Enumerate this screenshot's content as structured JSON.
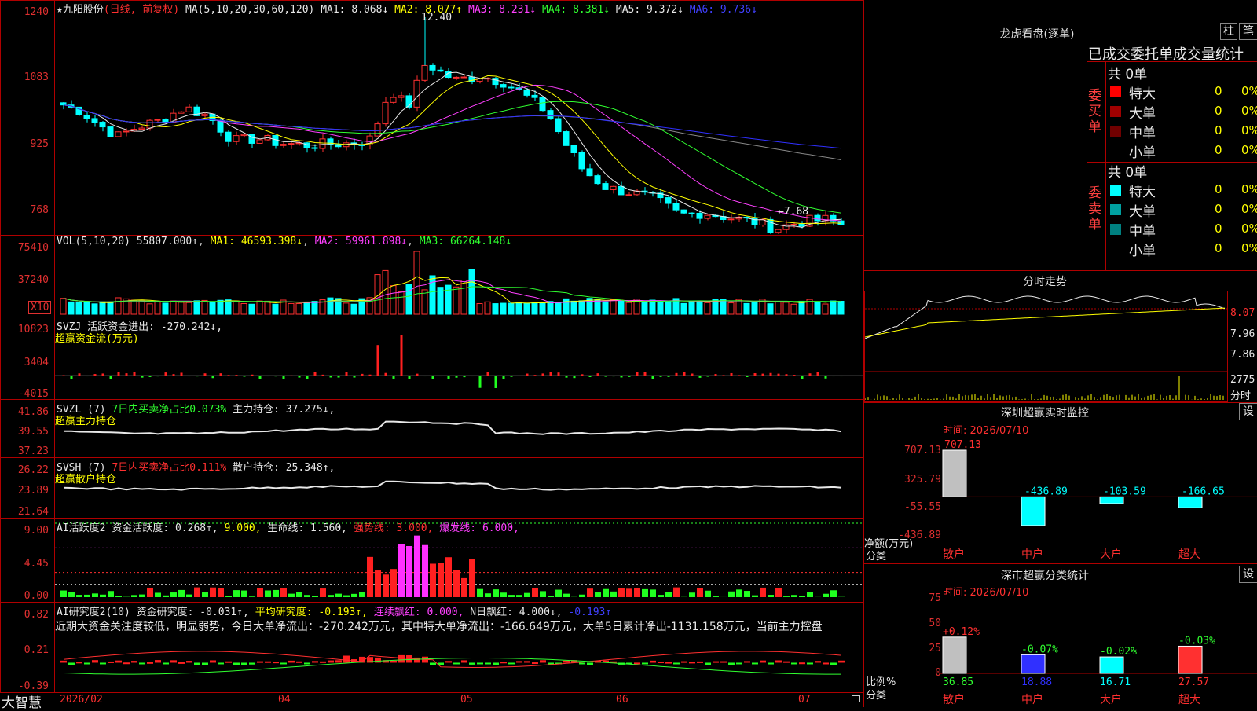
{
  "stock": {
    "star": "★",
    "name": "九阳股份",
    "mode": "(日线, 前复权)"
  },
  "ma_header": {
    "label": "MA(5,10,20,30,60,120)",
    "ma1": "MA1: 8.068↓",
    "ma2": "MA2: 8.077↑",
    "ma3": "MA3: 8.231↓",
    "ma4": "MA4: 8.381↓",
    "ma5": "MA5: 9.372↓",
    "ma6": "MA6: 9.736↓"
  },
  "price_axis": [
    "1240",
    "1083",
    "925",
    "768"
  ],
  "price_annotations": {
    "high": "12.40",
    "low": "←7.68"
  },
  "vol_header": {
    "label": "VOL(5,10,20)",
    "value": "55807.000↑",
    "ma1": "MA1: 46593.398↓",
    "ma2": "MA2: 59961.898↓",
    "ma3": "MA3: 66264.148↓"
  },
  "vol_axis": [
    "75410",
    "37240"
  ],
  "vol_unit": "X10",
  "svzj": {
    "label": "SVZJ  活跃资金进出: -270.242↓,",
    "sub": "超赢资金流(万元)",
    "axis": [
      "10823",
      "3404",
      "-4015"
    ]
  },
  "svzl": {
    "label": "SVZL (7)",
    "net": "7日内买卖净占比0.073%",
    "hold": "主力持仓: 37.275↓,",
    "sub": "超赢主力持仓",
    "axis": [
      "41.86",
      "39.55",
      "37.23"
    ]
  },
  "svsh": {
    "label": "SVSH (7)",
    "net": "7日内买卖净占比0.111%",
    "hold": "散户持仓: 25.348↑,",
    "sub": "超赢散户持仓",
    "axis": [
      "26.22",
      "23.89",
      "21.64"
    ]
  },
  "ai_active": {
    "label": "AI活跃度2",
    "a": "资金活跃度: 0.268↑,",
    "b": "9.000,",
    "c": "生命线: 1.560,",
    "d": "强势线: 3.000,",
    "e": "爆发线: 6.000,",
    "axis": [
      "9.00",
      "4.45",
      "0.00"
    ]
  },
  "ai_research": {
    "label": "AI研究度2(10)",
    "a": "资金研究度: -0.031↑,",
    "b": "平均研究度: -0.193↑,",
    "c": "连续飘红: 0.000,",
    "d": "N日飘红: 4.000↓,",
    "e": "-0.193↑",
    "axis": [
      "0.82",
      "0.21",
      "-0.39"
    ]
  },
  "ai_comment": "近期大资金关注度较低，明显弱势，今日大单净流出：-270.242万元，其中特大单净流出：-166.649万元，大单5日累计净出-1131.158万元，当前主力控盘",
  "date_axis": [
    "2026/02",
    "04",
    "05",
    "06",
    "07"
  ],
  "brand": "大智慧",
  "right_top": {
    "title": "龙虎看盘(逐单)",
    "btn1": "柱",
    "btn2": "笔",
    "header": "已成交委托单成交量统计",
    "buy_label": "委买单",
    "sell_label": "委卖单",
    "buy_total": "共 0单",
    "sell_total": "共 0单",
    "buy_rows": [
      {
        "name": "特大",
        "n": "0",
        "p": "0%",
        "color": "#ff0000"
      },
      {
        "name": "大单",
        "n": "0",
        "p": "0%",
        "color": "#a00000"
      },
      {
        "name": "中单",
        "n": "0",
        "p": "0%",
        "color": "#700000"
      },
      {
        "name": "小单",
        "n": "0",
        "p": "0%",
        "color": "#000000"
      }
    ],
    "sell_rows": [
      {
        "name": "特大",
        "n": "0",
        "p": "0%",
        "color": "#00ffff"
      },
      {
        "name": "大单",
        "n": "0",
        "p": "0%",
        "color": "#00a0a0"
      },
      {
        "name": "中单",
        "n": "0",
        "p": "0%",
        "color": "#008080"
      },
      {
        "name": "小单",
        "n": "0",
        "p": "0%",
        "color": "#000000"
      }
    ]
  },
  "minute": {
    "title": "分时走势",
    "axis": [
      "8.07",
      "7.96",
      "7.86"
    ],
    "vol_axis": "2775",
    "vol_unit": "分时"
  },
  "sz_monitor": {
    "title": "深圳超赢实时监控",
    "settings": "设",
    "time": "时间: 2026/07/10",
    "axis": [
      "707.13",
      "325.79",
      "-55.55",
      "-436.89"
    ],
    "ylabel": "净额(万元)",
    "xlabel": "分类",
    "cats": [
      "散户",
      "中户",
      "大户",
      "超大"
    ]
  },
  "sz_classify": {
    "title": "深市超赢分类统计",
    "settings": "设",
    "time": "时间: 2026/07/10",
    "axis": [
      "75",
      "50",
      "25",
      "0"
    ],
    "ylabel": "比例%",
    "xlabel": "分类",
    "cats": [
      "散户",
      "中户",
      "大户",
      "超大"
    ]
  },
  "chart_data": [
    {
      "type": "candlestick",
      "title": "九阳股份 日线",
      "ylim": [
        7.68,
        12.4
      ],
      "y_ticks": [
        "1240",
        "1083",
        "925",
        "768"
      ],
      "x_ticks": [
        "2026/02",
        "04",
        "05",
        "06",
        "07"
      ],
      "high": 12.4,
      "low": 7.68,
      "ma": {
        "MA1": 8.068,
        "MA2": 8.077,
        "MA3": 8.231,
        "MA4": 8.381,
        "MA5": 9.372,
        "MA6": 9.736
      }
    },
    {
      "type": "bar",
      "title": "VOL(5,10,20)",
      "ylim": [
        0,
        75410
      ],
      "last": 55807.0,
      "ma": {
        "MA1": 46593.398,
        "MA2": 59961.898,
        "MA3": 66264.148
      }
    },
    {
      "type": "bar",
      "title": "SVZJ 超赢资金流(万元)",
      "ylim": [
        -4015,
        10823
      ],
      "last": -270.242
    },
    {
      "type": "line",
      "title": "SVZL 超赢主力持仓",
      "ylim": [
        37.23,
        41.86
      ],
      "last": 37.275
    },
    {
      "type": "line",
      "title": "SVSH 超赢散户持仓",
      "ylim": [
        21.64,
        26.22
      ],
      "last": 25.348
    },
    {
      "type": "bar",
      "title": "AI活跃度2",
      "ylim": [
        0,
        9
      ],
      "lines": {
        "生命线": 1.56,
        "强势线": 3.0,
        "爆发线": 6.0
      },
      "last": 0.268
    },
    {
      "type": "bar",
      "title": "AI研究度2(10)",
      "ylim": [
        -0.39,
        0.82
      ],
      "last": -0.031,
      "avg": -0.193
    },
    {
      "type": "line",
      "title": "分时走势",
      "ylim": [
        7.86,
        8.07
      ]
    },
    {
      "type": "bar",
      "title": "深圳超赢实时监控",
      "categories": [
        "散户",
        "中户",
        "大户",
        "超大"
      ],
      "values": [
        707.13,
        -436.89,
        -103.59,
        -166.65
      ],
      "ylim": [
        -436.89,
        707.13
      ],
      "ylabel": "净额(万元)"
    },
    {
      "type": "bar",
      "title": "深市超赢分类统计",
      "categories": [
        "散户",
        "中户",
        "大户",
        "超大"
      ],
      "values": [
        36.85,
        18.88,
        16.71,
        27.57
      ],
      "changes": [
        "+0.12%",
        "-0.07%",
        "-0.02%",
        "-0.03%"
      ],
      "ylim": [
        0,
        75
      ],
      "ylabel": "比例%"
    }
  ]
}
